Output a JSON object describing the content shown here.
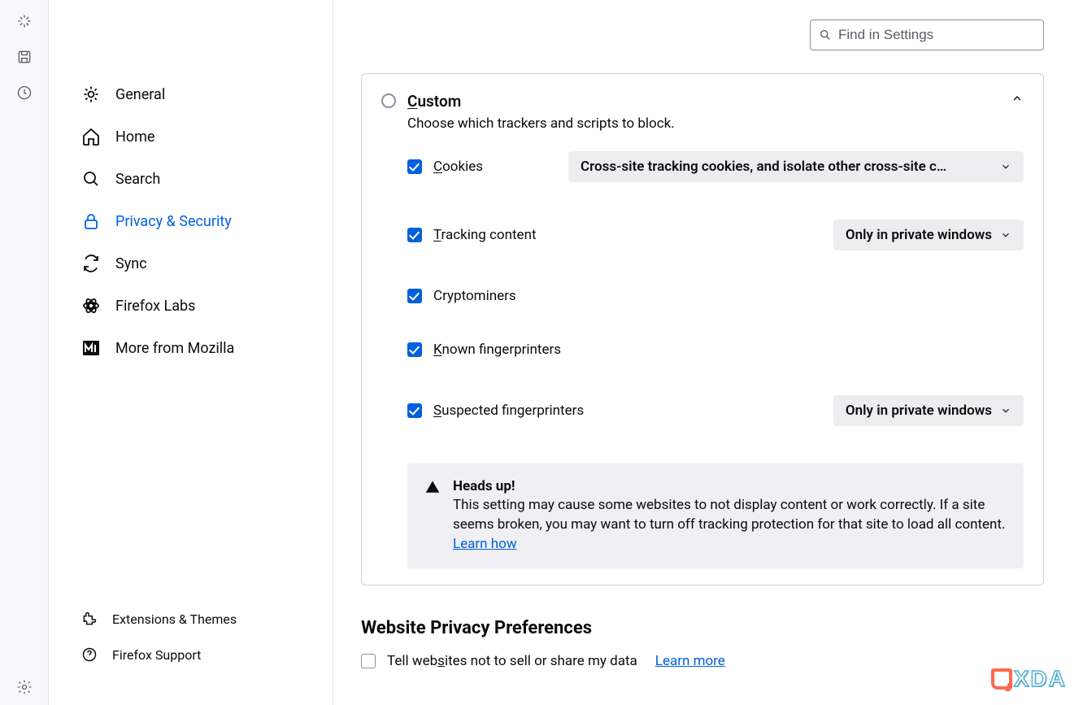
{
  "search": {
    "placeholder": "Find in Settings"
  },
  "sidebar": {
    "items": [
      {
        "label": "General"
      },
      {
        "label": "Home"
      },
      {
        "label": "Search"
      },
      {
        "label": "Privacy & Security"
      },
      {
        "label": "Sync"
      },
      {
        "label": "Firefox Labs"
      },
      {
        "label": "More from Mozilla"
      }
    ],
    "bottom": [
      {
        "label": "Extensions & Themes"
      },
      {
        "label": "Firefox Support"
      }
    ]
  },
  "custom": {
    "title_pre": "C",
    "title_rest": "ustom",
    "subtitle": "Choose which trackers and scripts to block.",
    "options": {
      "cookies": {
        "pre": "C",
        "rest": "ookies",
        "dropdown": "Cross-site tracking cookies, and isolate other cross-site c…"
      },
      "tracking": {
        "pre": "T",
        "rest": "racking content",
        "dropdown": "Only in private windows"
      },
      "crypto": {
        "pre": "",
        "rest": "Cryptominers"
      },
      "known": {
        "pre": "K",
        "rest": "nown fingerprinters"
      },
      "suspected": {
        "pre": "S",
        "rest": "uspected fingerprinters",
        "dropdown": "Only in private windows"
      }
    },
    "info": {
      "title": "Heads up!",
      "text": "This setting may cause some websites to not display content or work correctly. If a site seems broken, you may want to turn off tracking protection for that site to load all content. ",
      "link": "Learn how"
    }
  },
  "websitePrivacy": {
    "heading": "Website Privacy Preferences",
    "tellSites_pre": "Tell web",
    "tellSites_ul": "s",
    "tellSites_post": "ites not to sell or share my data",
    "learnMore": "Learn more"
  },
  "watermark": "XDA"
}
